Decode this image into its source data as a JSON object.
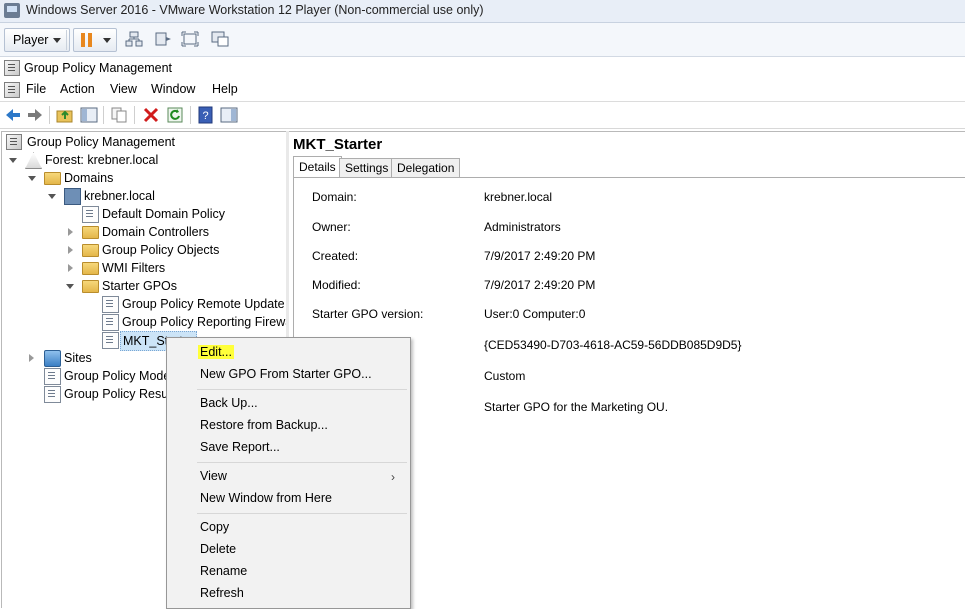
{
  "vm": {
    "title": "Windows Server 2016 - VMware Workstation 12 Player (Non-commercial use only)",
    "player_label": "Player",
    "accent": "#e8871e"
  },
  "mmc": {
    "title": "Group Policy Management",
    "menu": [
      "File",
      "Action",
      "View",
      "Window",
      "Help"
    ]
  },
  "tree": {
    "root": "Group Policy Management",
    "forest": "Forest: krebner.local",
    "domains": "Domains",
    "domain": "krebner.local",
    "default_domain_policy": "Default Domain Policy",
    "domain_controllers": "Domain Controllers",
    "group_policy_objects": "Group Policy Objects",
    "wmi_filters": "WMI Filters",
    "starter_gpos": "Starter GPOs",
    "starter_1": "Group Policy Remote Update F",
    "starter_2": "Group Policy Reporting Firewa",
    "starter_3": "MKT_Starter",
    "sites": "Sites",
    "modeling": "Group Policy Mode",
    "results": "Group Policy Result"
  },
  "details": {
    "title": "MKT_Starter",
    "tabs": [
      "Details",
      "Settings",
      "Delegation"
    ],
    "props": [
      {
        "label": "Domain:",
        "value": "krebner.local"
      },
      {
        "label": "Owner:",
        "value": "Administrators"
      },
      {
        "label": "Created:",
        "value": "7/9/2017 2:49:20 PM"
      },
      {
        "label": "Modified:",
        "value": "7/9/2017 2:49:20 PM"
      },
      {
        "label": "Starter GPO version:",
        "value": "User:0 Computer:0"
      },
      {
        "label": "",
        "value": "{CED53490-D703-4618-AC59-56DDB085D9D5}"
      },
      {
        "label": "",
        "value": "Custom"
      },
      {
        "label": "",
        "value": "Starter GPO for the Marketing OU."
      }
    ]
  },
  "context_menu": {
    "edit": "Edit...",
    "new_gpo": "New GPO From Starter GPO...",
    "back_up": "Back Up...",
    "restore": "Restore from Backup...",
    "save_report": "Save Report...",
    "view": "View",
    "new_window": "New Window from Here",
    "copy": "Copy",
    "delete": "Delete",
    "rename": "Rename",
    "refresh": "Refresh",
    "highlight_color": "#ffff3a",
    "submenu_arrow": "›"
  }
}
